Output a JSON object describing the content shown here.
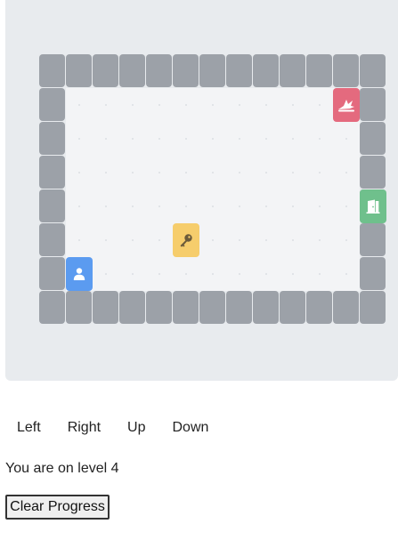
{
  "game": {
    "grid": {
      "cols": 13,
      "rows": 8
    },
    "walls": "perimeter",
    "pieces": {
      "player": {
        "col": 1,
        "row": 6,
        "icon": "person-icon",
        "color": "#5b9bf0"
      },
      "key": {
        "col": 5,
        "row": 5,
        "icon": "key-icon",
        "color": "#f6cd6c"
      },
      "enemy": {
        "col": 11,
        "row": 1,
        "icon": "dragon-icon",
        "color": "#e46a7e"
      },
      "door": {
        "col": 12,
        "row": 4,
        "icon": "door-icon",
        "color": "#6fc08c"
      }
    },
    "wall_color": "#9ca1a8",
    "floor_color": "#f3f4f6"
  },
  "controls": {
    "left_label": "Left",
    "right_label": "Right",
    "up_label": "Up",
    "down_label": "Down"
  },
  "status": {
    "level_text": "You are on level 4"
  },
  "clear_button_label": "Clear Progress"
}
